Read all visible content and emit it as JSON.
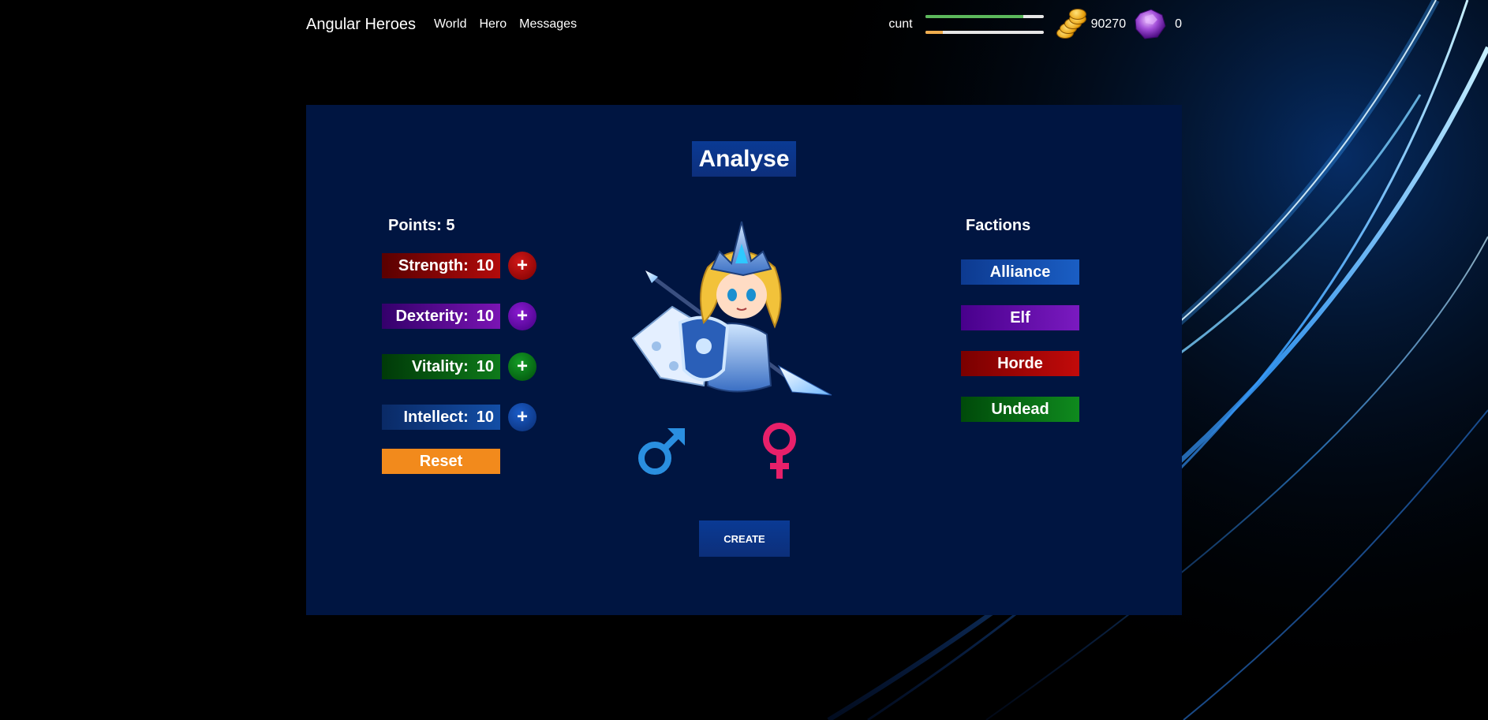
{
  "nav": {
    "brand": "Angular Heroes",
    "links": [
      "World",
      "Hero",
      "Messages"
    ],
    "username": "cunt",
    "hp_fraction": 0.83,
    "xp_fraction": 0.15,
    "gold": "90270",
    "gems": "0"
  },
  "main": {
    "title": "Analyse",
    "points_label": "Points: 5",
    "stats": [
      {
        "label": "Strength:",
        "value": "10",
        "plus": "+"
      },
      {
        "label": "Dexterity:",
        "value": "10",
        "plus": "+"
      },
      {
        "label": "Vitality:",
        "value": "10",
        "plus": "+"
      },
      {
        "label": "Intellect:",
        "value": "10",
        "plus": "+"
      }
    ],
    "reset_label": "Reset",
    "create_label": "CREATE",
    "factions_title": "Factions",
    "factions": [
      "Alliance",
      "Elf",
      "Horde",
      "Undead"
    ]
  },
  "colors": {
    "panel": "#001541",
    "male": "#2a8fe0",
    "female": "#e8206a",
    "reset": "#f28a1c"
  },
  "icons": {
    "gold": "gold-coins-icon",
    "gem": "purple-gem-icon",
    "male": "male-symbol-icon",
    "female": "female-symbol-icon"
  }
}
